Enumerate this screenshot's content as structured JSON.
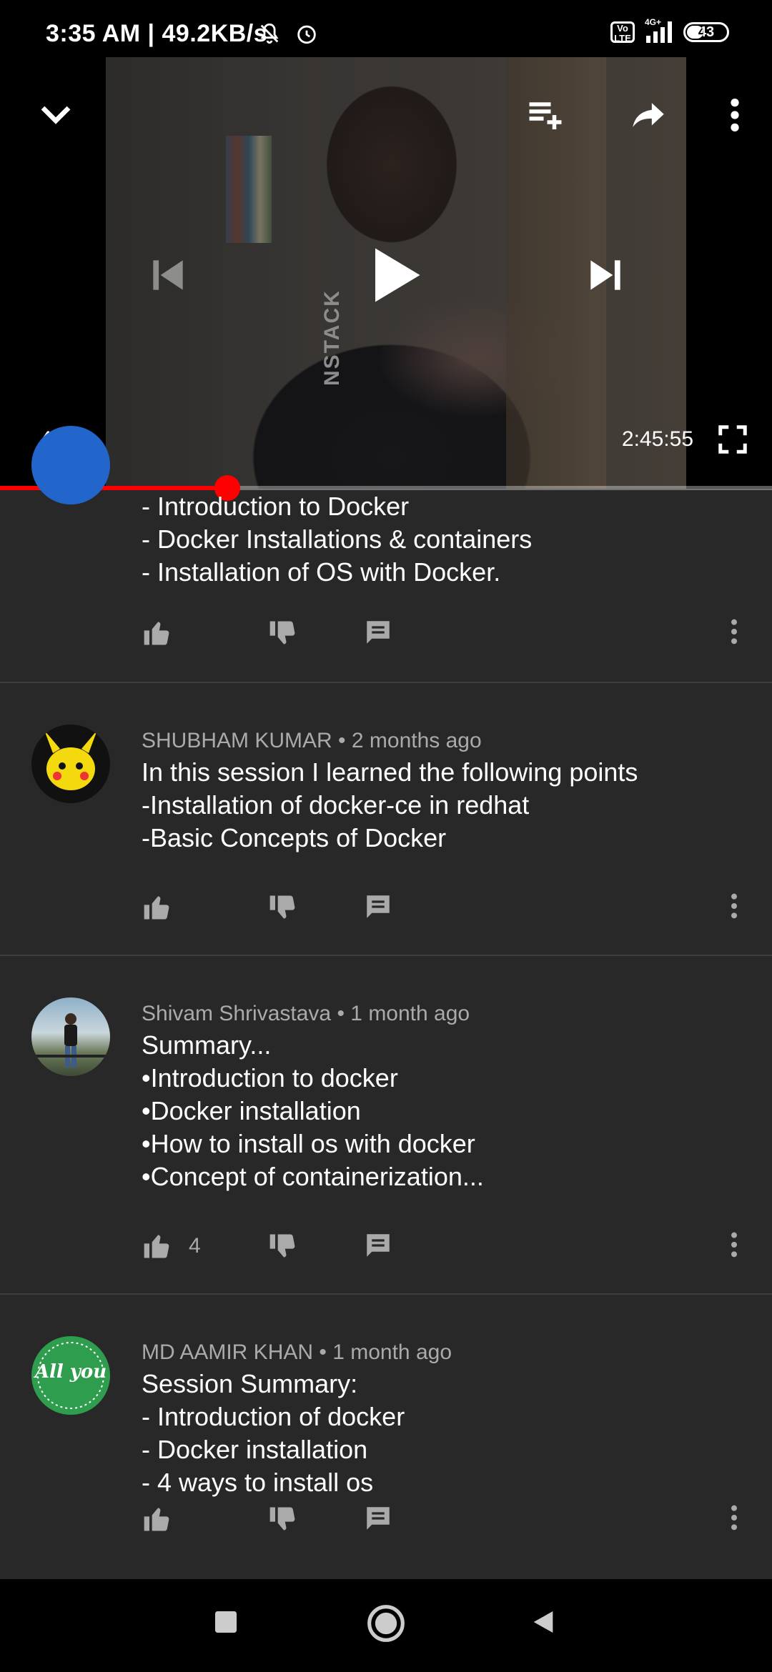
{
  "status_bar": {
    "time": "3:35 AM | 49.2KB/s",
    "volte_label": "Vo LTE",
    "network_label": "4G+",
    "battery": "43"
  },
  "player": {
    "current_time": "48:46",
    "total_time": "2:45:55",
    "progress_fraction": 0.294,
    "shirt_text": "NSTACK"
  },
  "comments": [
    {
      "author": "",
      "age": "",
      "text": "- Introduction to Docker\n- Docker Installations & containers\n- Installation of OS with Docker.",
      "likes": ""
    },
    {
      "author": "SHUBHAM KUMAR",
      "age": "2 months ago",
      "text": "In this session I learned the following points\n-Installation of docker-ce in redhat\n-Basic Concepts of Docker",
      "likes": ""
    },
    {
      "author": "Shivam Shrivastava",
      "age": "1 month ago",
      "text": "Summary...\n•Introduction to docker\n•Docker installation\n•How to install os with docker\n•Concept of containerization...",
      "likes": "4"
    },
    {
      "author": "MD AAMIR KHAN",
      "age": "1 month ago",
      "text": "Session Summary:\n- Introduction of docker\n- Docker installation\n- 4 ways to install os",
      "likes": ""
    }
  ],
  "meta_separator": " • ",
  "avatar_logo_text": "All you",
  "colors": {
    "accent": "#ff0000",
    "background": "#282828",
    "meta_text": "#aaaaaa"
  }
}
